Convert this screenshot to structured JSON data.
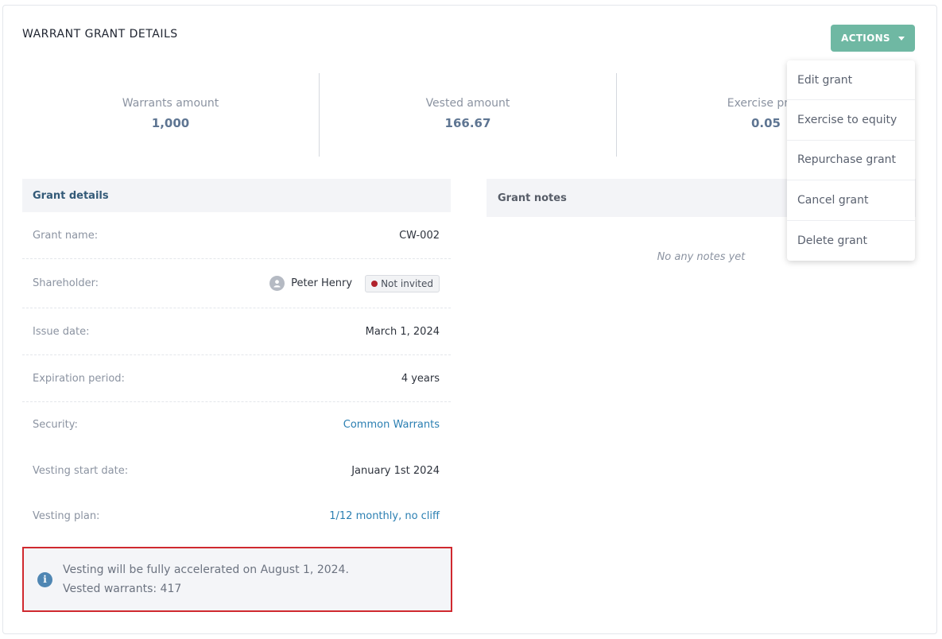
{
  "page": {
    "title": "WARRANT GRANT DETAILS"
  },
  "actions": {
    "label": "ACTIONS",
    "menu": [
      "Edit grant",
      "Exercise to equity",
      "Repurchase grant",
      "Cancel grant",
      "Delete grant"
    ]
  },
  "stats": [
    {
      "label": "Warrants amount",
      "value": "1,000"
    },
    {
      "label": "Vested amount",
      "value": "166.67"
    },
    {
      "label": "Exercise price",
      "value": "0.05"
    }
  ],
  "grant_details": {
    "title": "Grant details",
    "grant_name_label": "Grant name:",
    "grant_name": "CW-002",
    "shareholder_label": "Shareholder:",
    "shareholder_name": "Peter Henry",
    "shareholder_status": "Not invited",
    "issue_date_label": "Issue date:",
    "issue_date": "March 1, 2024",
    "expiration_label": "Expiration period:",
    "expiration": "4 years",
    "security_label": "Security:",
    "security": "Common Warrants",
    "vesting_start_label": "Vesting start date:",
    "vesting_start": "January 1st 2024",
    "vesting_plan_label": "Vesting plan:",
    "vesting_plan": "1/12 monthly, no cliff"
  },
  "info": {
    "line1": "Vesting will be fully accelerated on August 1, 2024.",
    "line2": "Vested warrants: 417"
  },
  "grant_notes": {
    "title": "Grant notes",
    "empty": "No any notes yet"
  },
  "colors": {
    "accent": "#6fb8a3",
    "link": "#2b7fb2",
    "status_not_invited": "#b0222c",
    "highlight_border": "#d0292f"
  }
}
